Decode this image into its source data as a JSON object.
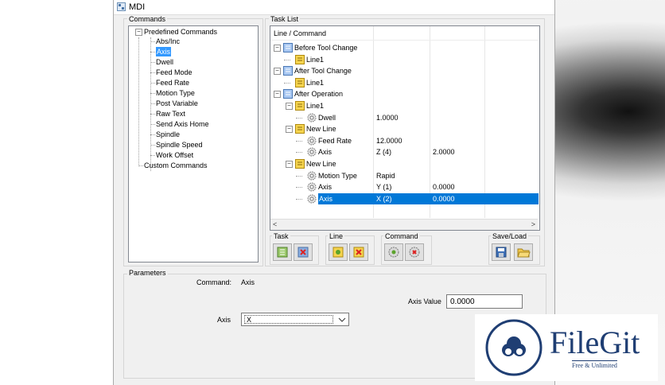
{
  "window": {
    "title": "MDI"
  },
  "commands": {
    "group_label": "Commands",
    "predefined_label": "Predefined Commands",
    "items": [
      "Abs/Inc",
      "Axis",
      "Dwell",
      "Feed Mode",
      "Feed Rate",
      "Motion Type",
      "Post Variable",
      "Raw Text",
      "Send Axis Home",
      "Spindle",
      "Spindle Speed",
      "Work Offset"
    ],
    "selected_item": "Axis",
    "custom_label": "Custom Commands"
  },
  "task_list": {
    "group_label": "Task List",
    "header": "Line / Command",
    "rows": [
      {
        "label": "Before Tool Change",
        "v1": "",
        "v2": ""
      },
      {
        "label": "Line1",
        "v1": "",
        "v2": ""
      },
      {
        "label": "After Tool Change",
        "v1": "",
        "v2": ""
      },
      {
        "label": "Line1",
        "v1": "",
        "v2": ""
      },
      {
        "label": "After Operation",
        "v1": "",
        "v2": ""
      },
      {
        "label": "Line1",
        "v1": "",
        "v2": ""
      },
      {
        "label": "Dwell",
        "v1": "1.0000",
        "v2": ""
      },
      {
        "label": "New Line",
        "v1": "",
        "v2": ""
      },
      {
        "label": "Feed Rate",
        "v1": "12.0000",
        "v2": ""
      },
      {
        "label": "Axis",
        "v1": "Z (4)",
        "v2": "2.0000"
      },
      {
        "label": "New Line",
        "v1": "",
        "v2": ""
      },
      {
        "label": "Motion Type",
        "v1": "Rapid",
        "v2": ""
      },
      {
        "label": "Axis",
        "v1": "Y (1)",
        "v2": "0.0000"
      },
      {
        "label": "Axis",
        "v1": "X (2)",
        "v2": "0.0000"
      }
    ],
    "scroll_left": "<",
    "scroll_right": ">"
  },
  "toolbar": {
    "task_label": "Task",
    "line_label": "Line",
    "command_label": "Command",
    "saveload_label": "Save/Load"
  },
  "parameters": {
    "group_label": "Parameters",
    "command_label": "Command:",
    "command_value": "Axis",
    "axis_value_label": "Axis Value",
    "axis_value": "0.0000",
    "axis_label": "Axis",
    "axis_selected": "X"
  },
  "watermark": {
    "brand": "FileGit",
    "tagline": "Free & Unlimited"
  }
}
